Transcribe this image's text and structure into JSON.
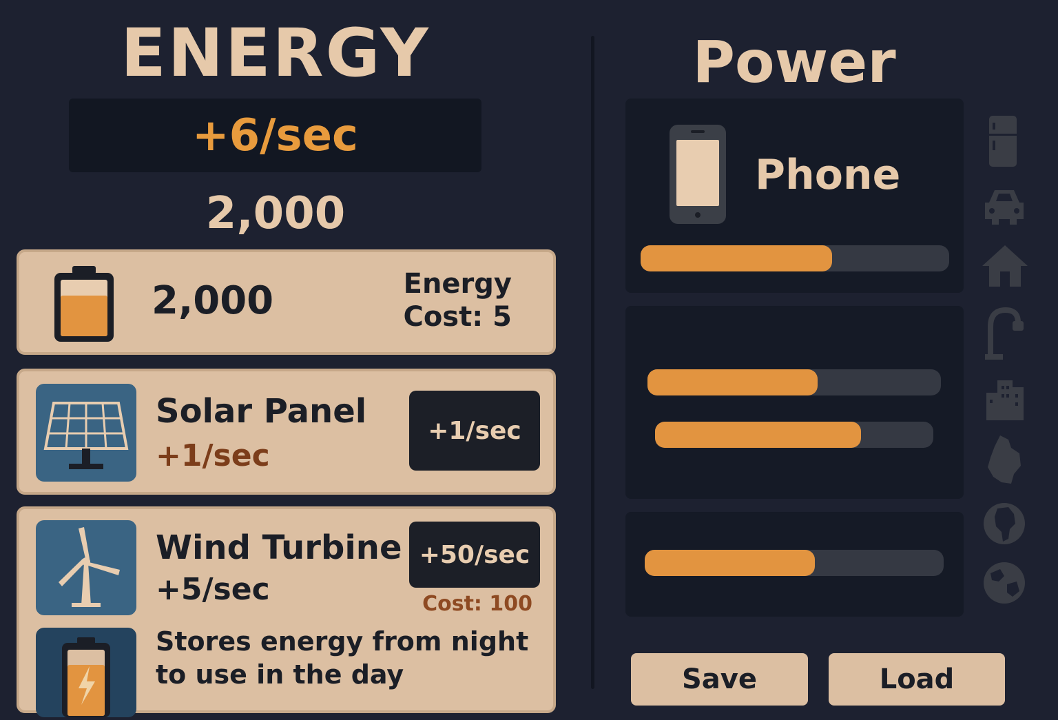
{
  "energy": {
    "title": "ENERGY",
    "rate": "+6/sec",
    "total": "2,000"
  },
  "battery_card": {
    "amount": "2,000",
    "cost_line1": "Energy",
    "cost_line2": "Cost: 5",
    "fill_fraction": 0.72
  },
  "solar": {
    "name": "Solar Panel",
    "rate": "+1/sec",
    "button": "+1/sec"
  },
  "wind": {
    "name": "Wind Turbine",
    "rate": "+5/sec",
    "button": "+50/sec",
    "cost": "Cost: 100",
    "description_line1": "Stores energy from night",
    "description_line2": "to use in the day"
  },
  "power": {
    "title": "Power",
    "phone_label": "Phone",
    "phone_progress": 0.62,
    "panel2_progress_a": 0.58,
    "panel2_progress_b": 0.74,
    "panel3_progress": 0.57
  },
  "sidebar_icons": [
    "fridge-icon",
    "car-icon",
    "house-icon",
    "streetlight-icon",
    "city-icon",
    "continent-icon",
    "africa-globe-icon",
    "earth-icon"
  ],
  "footer": {
    "save": "Save",
    "load": "Load"
  },
  "colors": {
    "background": "#1d2130",
    "accent_orange": "#e29440",
    "card_tan": "#dcbfa2",
    "icon_blue": "#3a6483"
  }
}
